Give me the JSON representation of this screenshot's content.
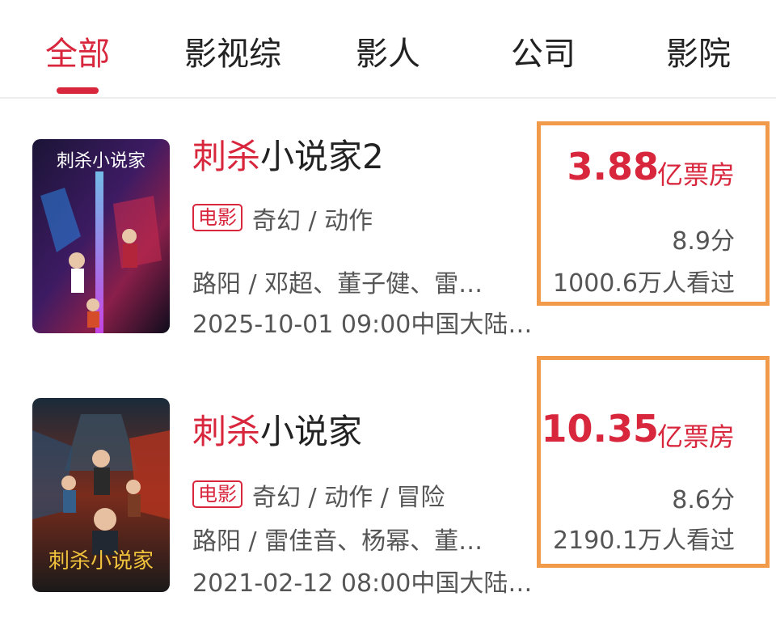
{
  "tabs": [
    {
      "label": "全部",
      "active": true
    },
    {
      "label": "影视综",
      "active": false
    },
    {
      "label": "影人",
      "active": false
    },
    {
      "label": "公司",
      "active": false
    },
    {
      "label": "影院",
      "active": false
    }
  ],
  "results": [
    {
      "title_highlight": "刺杀",
      "title_rest": "小说家2",
      "poster_title": "刺杀小说家",
      "type_tag": "电影",
      "genres": "奇幻 / 动作",
      "cast": "路阳 / 邓超、董子健、雷…",
      "release": "2025-10-01 09:00中国大陆…",
      "box_office_value": "3.88",
      "box_office_unit": "亿票房",
      "score": "8.9分",
      "viewers": "1000.6万人看过"
    },
    {
      "title_highlight": "刺杀",
      "title_rest": "小说家",
      "poster_title": "刺杀小说家",
      "type_tag": "电影",
      "genres": "奇幻 / 动作 / 冒险",
      "cast": "路阳 / 雷佳音、杨幂、董…",
      "release": "2021-02-12 08:00中国大陆…",
      "box_office_value": "10.35",
      "box_office_unit": "亿票房",
      "score": "8.6分",
      "viewers": "2190.1万人看过"
    }
  ],
  "colors": {
    "accent": "#d8263d",
    "highlight_box": "#f19a4a"
  }
}
